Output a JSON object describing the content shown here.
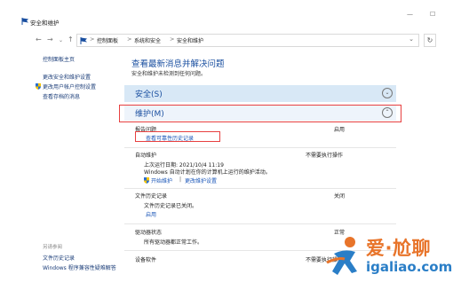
{
  "window": {
    "title": "安全和维护",
    "min": "—",
    "max": "☐"
  },
  "address": {
    "back": "←",
    "forward": "→",
    "down": "⌄",
    "up": "↑",
    "crumbs": [
      "控制面板",
      "系统和安全",
      "安全和维护"
    ],
    "sep": ">",
    "dropdown": "⌄",
    "refresh": "↻"
  },
  "sidebar": {
    "items": [
      "控制面板主页",
      "更改安全和维护设置",
      "更改用户帐户控制设置",
      "查看存档的消息"
    ],
    "see_also_heading": "另请参阅",
    "see_also": [
      "文件历史记录",
      "Windows 程序兼容性疑难解答"
    ]
  },
  "main": {
    "title": "查看最新消息并解决问题",
    "subtitle": "安全和维护未检测到任何问题。",
    "security": {
      "label": "安全(S)",
      "toggle": "⌄"
    },
    "maintenance": {
      "label": "维护(M)",
      "toggle": "⌃"
    },
    "items": [
      {
        "head": "报告问题",
        "status": "启用",
        "link": "查看可靠性历史记录"
      },
      {
        "head": "自动维护",
        "status": "不需要执行操作",
        "line1": "上次运行日期: 2021/10/4 11:19",
        "line2": "Windows 自动计划在你的计算机上运行的维护活动。",
        "link1": "开始维护",
        "linksep": "|",
        "link2": "更改维护设置"
      },
      {
        "head": "文件历史记录",
        "status": "关闭",
        "line1": "文件历史记录已关闭。",
        "link": "启用"
      },
      {
        "head": "驱动器状态",
        "status": "正常",
        "line1": "所有驱动器都正常工作。"
      },
      {
        "head": "设备软件",
        "status": "不需要执行操作"
      }
    ]
  },
  "watermark": {
    "line1": "爱·尬聊",
    "line2": "igaliao.com"
  },
  "colors": {
    "accent": "#1a4fa0",
    "highlight": "#e74040",
    "bar": "#d8e8f6",
    "link": "#1a56b8"
  }
}
